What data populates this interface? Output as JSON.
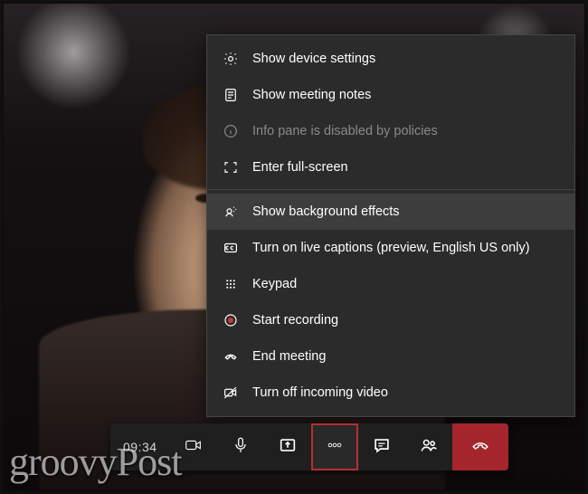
{
  "menu": {
    "items": [
      {
        "label": "Show device settings",
        "icon": "gear-icon",
        "disabled": false
      },
      {
        "label": "Show meeting notes",
        "icon": "notes-icon",
        "disabled": false
      },
      {
        "label": "Info pane is disabled by policies",
        "icon": "info-icon",
        "disabled": true
      },
      {
        "label": "Enter full-screen",
        "icon": "fullscreen-icon",
        "disabled": false
      },
      {
        "label": "Show background effects",
        "icon": "background-effects-icon",
        "disabled": false,
        "hover": true
      },
      {
        "label": "Turn on live captions (preview, English US only)",
        "icon": "captions-icon",
        "disabled": false
      },
      {
        "label": "Keypad",
        "icon": "keypad-icon",
        "disabled": false
      },
      {
        "label": "Start recording",
        "icon": "record-icon",
        "disabled": false
      },
      {
        "label": "End meeting",
        "icon": "end-meeting-icon",
        "disabled": false
      },
      {
        "label": "Turn off incoming video",
        "icon": "video-off-icon",
        "disabled": false
      }
    ],
    "separator_after_index": 3
  },
  "toolbar": {
    "duration": "09:34",
    "buttons": {
      "camera": "Camera",
      "mic": "Microphone",
      "share": "Share screen",
      "more": "More actions",
      "chat": "Chat",
      "people": "Participants",
      "hangup": "Hang up"
    },
    "active_button": "more"
  },
  "watermark": "groovyPost"
}
